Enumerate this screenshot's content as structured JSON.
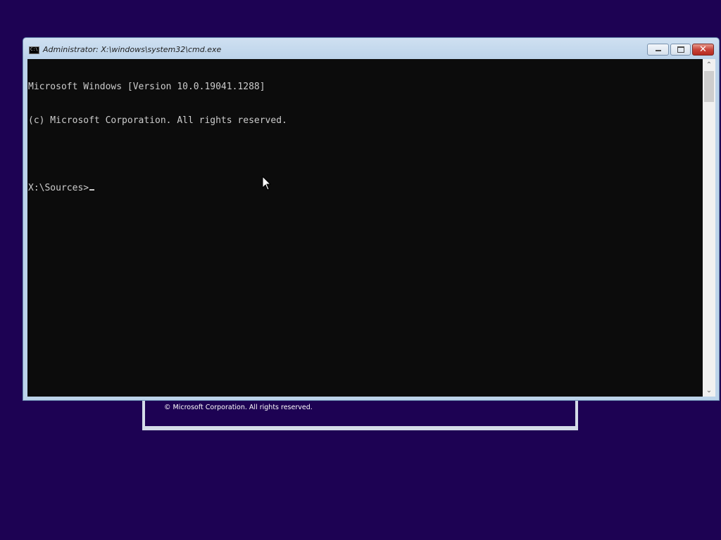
{
  "window": {
    "title": "Administrator: X:\\windows\\system32\\cmd.exe",
    "icon": "cmd-icon",
    "icon_text": "C:\\",
    "close_glyph": "✕"
  },
  "console": {
    "lines": [
      "Microsoft Windows [Version 10.0.19041.1288]",
      "(c) Microsoft Corporation. All rights reserved.",
      "",
      "X:\\Sources>"
    ],
    "text_color": "#cccccc",
    "background": "#0c0c0c"
  },
  "scrollbar": {
    "up_arrow": "⌃",
    "down_arrow": "⌄"
  },
  "setup_dialog": {
    "copyright": "© Microsoft Corporation. All rights reserved."
  },
  "desktop": {
    "background": "#1d0253"
  }
}
